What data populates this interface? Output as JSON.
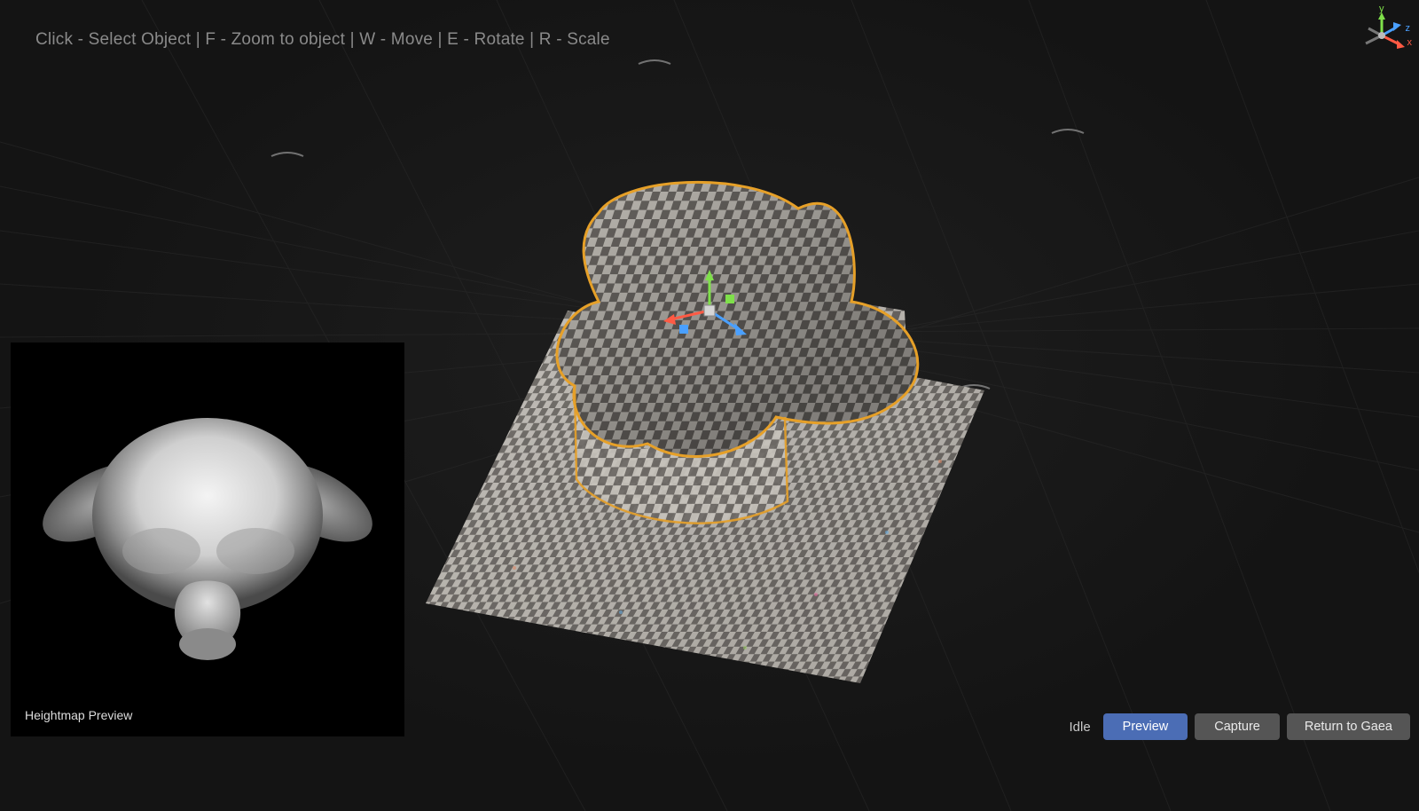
{
  "hints": {
    "text": "Click - Select Object | F - Zoom to object | W - Move | E - Rotate | R - Scale"
  },
  "axis": {
    "y": "y",
    "z": "z",
    "x": "x"
  },
  "heightmap": {
    "label": "Heightmap Preview"
  },
  "status": {
    "text": "Idle"
  },
  "buttons": {
    "preview": "Preview",
    "capture": "Capture",
    "return": "Return to Gaea"
  },
  "colors": {
    "accent": "#4b6db5",
    "outline": "#e6a028",
    "axis_x": "#ff5a44",
    "axis_y": "#7fe04a",
    "axis_z": "#4aa0ff"
  }
}
